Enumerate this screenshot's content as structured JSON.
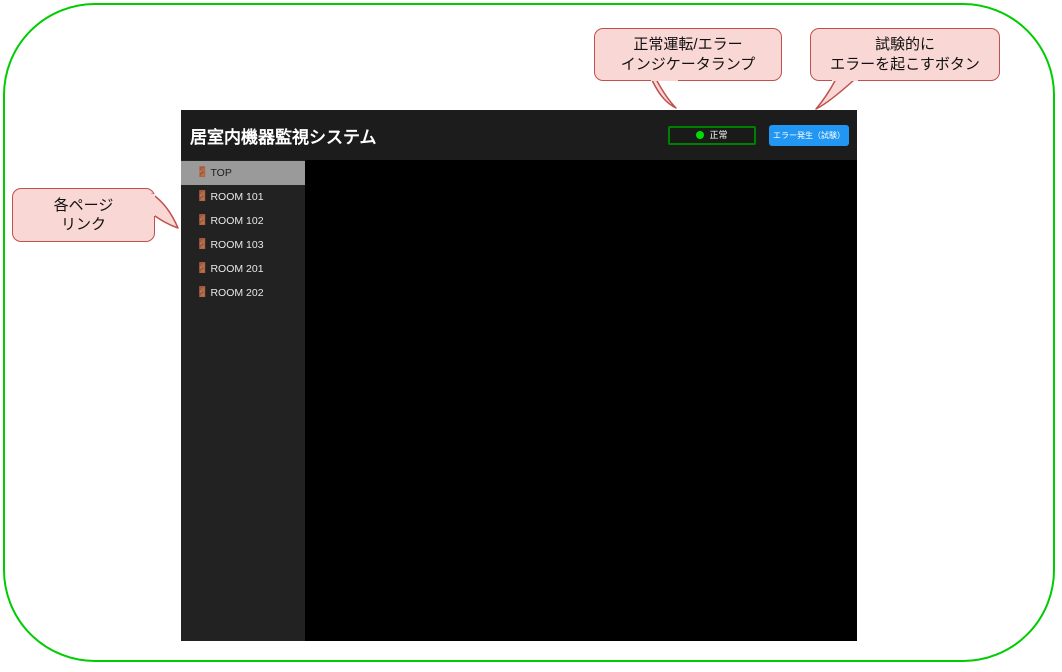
{
  "frame": {
    "border_color": "#00cc00"
  },
  "app": {
    "title": "居室内機器監視システム",
    "header": {
      "status": {
        "label": "正常",
        "lamp_color": "#00dd00",
        "border_color": "#008000",
        "icon": "status-lamp-icon"
      },
      "error_button": {
        "label": "エラー発生（試験）",
        "color": "#2196f3"
      }
    },
    "sidebar": {
      "items": [
        {
          "label": "TOP",
          "icon": "door-icon",
          "active": true
        },
        {
          "label": "ROOM 101",
          "icon": "door-icon",
          "active": false
        },
        {
          "label": "ROOM 102",
          "icon": "door-icon",
          "active": false
        },
        {
          "label": "ROOM 103",
          "icon": "door-icon",
          "active": false
        },
        {
          "label": "ROOM 201",
          "icon": "door-icon",
          "active": false
        },
        {
          "label": "ROOM 202",
          "icon": "door-icon",
          "active": false
        }
      ],
      "icon_glyph": "🚪",
      "background": "#222222",
      "active_background": "#9a9a9a"
    },
    "content": {
      "background": "#000000"
    }
  },
  "annotations": [
    {
      "id": "callout-indicator",
      "line1": "正常運転/エラー",
      "line2": "インジケータランプ"
    },
    {
      "id": "callout-error-button",
      "line1": "試験的に",
      "line2": "エラーを起こすボタン"
    },
    {
      "id": "callout-page-links",
      "line1": "各ページ",
      "line2": "リンク"
    }
  ],
  "annotation_style": {
    "fill": "#f8d7d4",
    "stroke": "#c0504d"
  }
}
